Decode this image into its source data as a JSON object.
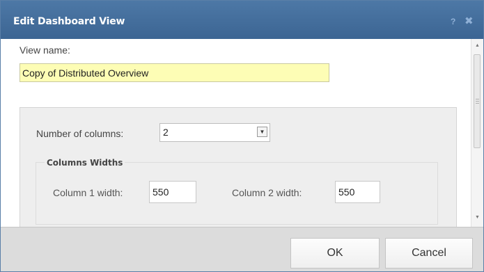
{
  "dialog": {
    "title": "Edit Dashboard View",
    "help_glyph": "?",
    "close_glyph": "✖"
  },
  "view_name": {
    "label": "View name:",
    "value": "Copy of Distributed Overview"
  },
  "columns": {
    "label": "Number of columns:",
    "selected": "2",
    "arrow_glyph": "▼"
  },
  "widths": {
    "legend": "Columns Widths",
    "col1_label": "Column 1 width:",
    "col1_value": "550",
    "col2_label": "Column 2 width:",
    "col2_value": "550"
  },
  "footer": {
    "ok_label": "OK",
    "cancel_label": "Cancel"
  },
  "scrollbar": {
    "up_glyph": "▲",
    "down_glyph": "▼"
  },
  "icons": [
    "help-icon",
    "close-icon",
    "chevron-down-icon",
    "scroll-up-icon",
    "scroll-down-icon"
  ],
  "colors": {
    "titlebar": "#4470a0",
    "name_field_bg": "#fdfdb5",
    "panel_bg": "#eeeeee",
    "footer_bg": "#dcdcdc"
  }
}
